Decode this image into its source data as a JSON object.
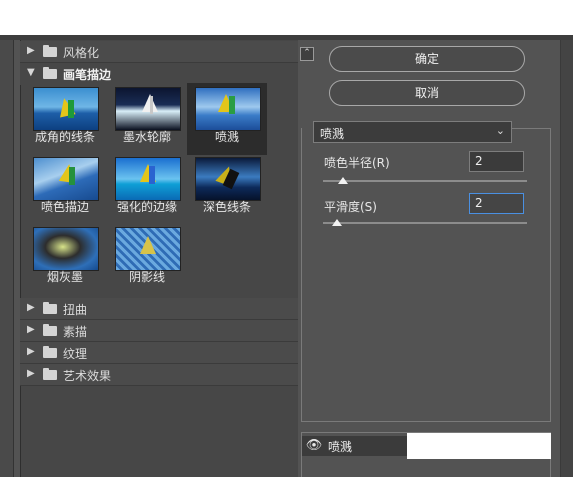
{
  "categories_above": [
    {
      "label": "风格化",
      "expanded": false
    }
  ],
  "open_category": {
    "label": "画笔描边",
    "expanded": true
  },
  "thumbnails": [
    {
      "label": "成角的线条",
      "selected": false
    },
    {
      "label": "墨水轮廓",
      "selected": false
    },
    {
      "label": "喷溅",
      "selected": true
    },
    {
      "label": "喷色描边",
      "selected": false
    },
    {
      "label": "强化的边缘",
      "selected": false
    },
    {
      "label": "深色线条",
      "selected": false
    },
    {
      "label": "烟灰墨",
      "selected": false
    },
    {
      "label": "阴影线",
      "selected": false
    }
  ],
  "categories_below": [
    {
      "label": "扭曲",
      "expanded": false
    },
    {
      "label": "素描",
      "expanded": false
    },
    {
      "label": "纹理",
      "expanded": false
    },
    {
      "label": "艺术效果",
      "expanded": false
    }
  ],
  "buttons": {
    "ok": "确定",
    "cancel": "取消"
  },
  "filter_select": {
    "value": "喷溅"
  },
  "params": {
    "spray_radius": {
      "label": "喷色半径(R)",
      "value": "2",
      "level": 0.1
    },
    "smoothness": {
      "label": "平滑度(S)",
      "value": "2",
      "level": 0.07
    }
  },
  "layer": {
    "name": "喷溅",
    "icon": "eye-icon"
  },
  "colors": {
    "background": "#535353",
    "focus": "#4a90e2"
  }
}
